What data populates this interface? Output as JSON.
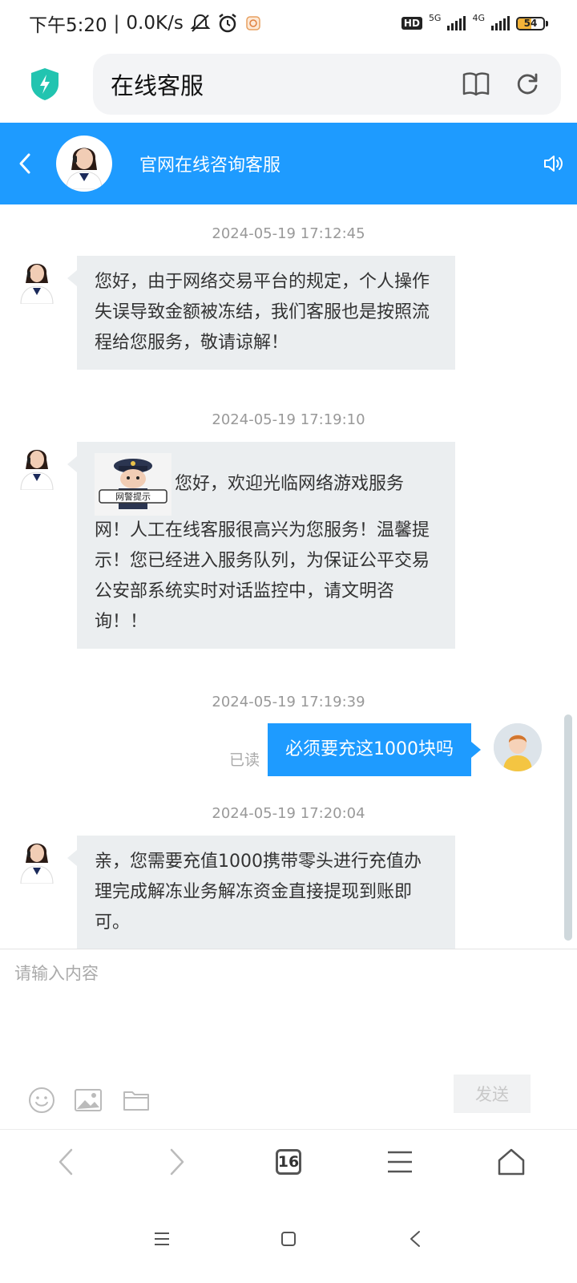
{
  "status_bar": {
    "time": "下午5:20",
    "separator": "|",
    "network_speed": "0.0K/s",
    "hd_badge": "HD",
    "net1": "5G",
    "net2": "4G",
    "battery": "54",
    "battery_level": 0.54
  },
  "browser": {
    "url_title": "在线客服",
    "icons": [
      "shield-icon",
      "book-icon",
      "refresh-icon"
    ]
  },
  "chat_header": {
    "title": "官网在线咨询客服",
    "back_icon": "chevron-left-icon",
    "speaker_icon": "speaker-icon"
  },
  "messages": [
    {
      "timestamp": "2024-05-19 17:12:45",
      "from": "agent",
      "text": "您好，由于网络交易平台的规定，个人操作失误导致金额被冻结，我们客服也是按照流程给您服务，敬请谅解！"
    },
    {
      "timestamp": "2024-05-19 17:19:10",
      "from": "agent",
      "image_caption": "网警提示",
      "text_inline": "您好，欢迎光临网络游戏服务",
      "text": "网！人工在线客服很高兴为您服务！温馨提示！您已经进入服务队列，为保证公平交易公安部系统实时对话监控中，请文明咨询！！"
    },
    {
      "timestamp": "2024-05-19 17:19:39",
      "from": "user",
      "status": "已读",
      "text": "必须要充这1000块吗"
    },
    {
      "timestamp": "2024-05-19 17:20:04",
      "from": "agent",
      "text": "亲，您需要充值1000携带零头进行充值办理完成解冻业务解冻资金直接提现到账即可。"
    }
  ],
  "input": {
    "placeholder": "请输入内容",
    "send_label": "发送",
    "tools": [
      "emoji-icon",
      "image-icon",
      "folder-icon"
    ]
  },
  "browser_nav": {
    "tab_count": "16"
  },
  "colors": {
    "accent": "#1e9bff",
    "bubble_agent": "#ebeef0",
    "shield": "#22c4b0"
  }
}
